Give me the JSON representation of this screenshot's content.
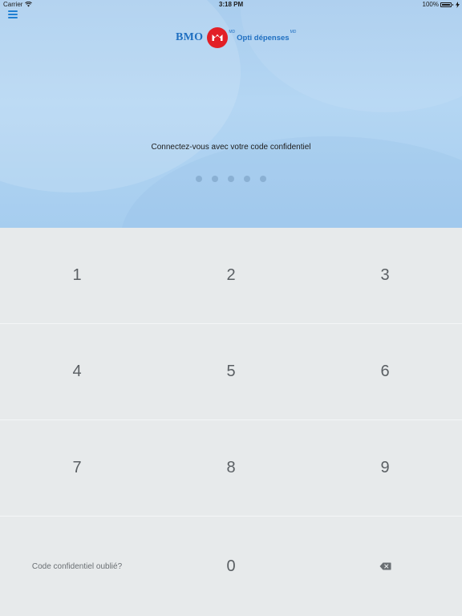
{
  "status_bar": {
    "carrier": "Carrier",
    "time": "3:18 PM",
    "battery": "100%",
    "battery_level": 1.0,
    "icons": [
      "wifi-icon",
      "battery-icon",
      "charging-icon"
    ]
  },
  "header": {
    "menu_icon": "hamburger-menu-icon",
    "logo_brand": "BMO",
    "logo_product": "Opti dépenses",
    "logo_superscript": "MD"
  },
  "login": {
    "prompt": "Connectez-vous avec votre code confidentiel",
    "pin_length": 5,
    "pin_entered": 0
  },
  "keypad": {
    "keys": [
      "1",
      "2",
      "3",
      "4",
      "5",
      "6",
      "7",
      "8",
      "9"
    ],
    "forgot_label": "Code confidentiel oublié?",
    "zero": "0",
    "backspace_icon": "backspace-icon"
  },
  "colors": {
    "brand_blue": "#1f6fc1",
    "brand_red": "#e21f26",
    "hero_blue": "#b0d3f1",
    "keypad_bg": "#e7eaeb"
  }
}
